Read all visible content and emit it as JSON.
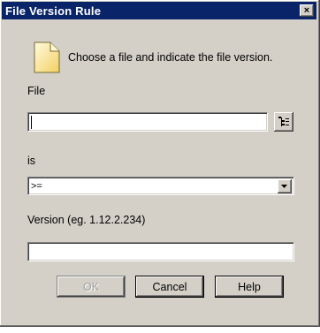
{
  "window": {
    "title": "File Version Rule",
    "close_glyph": "×"
  },
  "intro": {
    "icon": "document-icon",
    "text": "Choose a file and indicate the file version."
  },
  "file": {
    "label": "File",
    "value": "",
    "browse_icon": "browse-icon"
  },
  "operator": {
    "label": "is",
    "value": ">="
  },
  "version": {
    "label": "Version (eg. 1.12.2.234)",
    "value": ""
  },
  "buttons": {
    "ok": "OK",
    "cancel": "Cancel",
    "help": "Help"
  }
}
